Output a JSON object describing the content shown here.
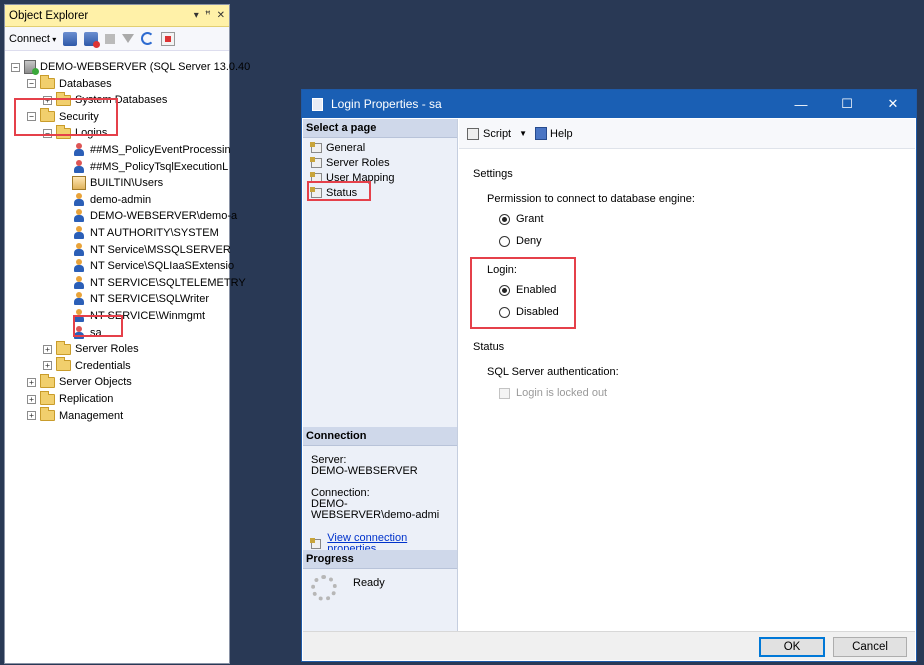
{
  "object_explorer": {
    "title": "Object Explorer",
    "title_buttons": [
      "▾",
      "ꟸ",
      "✕"
    ],
    "toolbar": {
      "connect_label": "Connect"
    },
    "tree": [
      {
        "label": "DEMO-WEBSERVER (SQL Server 13.0.40",
        "icon": "server",
        "indent": 0,
        "expander": "−"
      },
      {
        "label": "Databases",
        "icon": "folder",
        "indent": 1,
        "expander": "−"
      },
      {
        "label": "System Databases",
        "icon": "folder",
        "indent": 2,
        "expander": "+"
      },
      {
        "label": "Security",
        "icon": "folder",
        "indent": 1,
        "expander": "−"
      },
      {
        "label": "Logins",
        "icon": "folder",
        "indent": 2,
        "expander": "−"
      },
      {
        "label": "##MS_PolicyEventProcessin",
        "icon": "user-warn",
        "indent": 3,
        "expander": ""
      },
      {
        "label": "##MS_PolicyTsqlExecutionL",
        "icon": "user-warn",
        "indent": 3,
        "expander": ""
      },
      {
        "label": "BUILTIN\\Users",
        "icon": "group",
        "indent": 3,
        "expander": ""
      },
      {
        "label": "demo-admin",
        "icon": "user",
        "indent": 3,
        "expander": ""
      },
      {
        "label": "DEMO-WEBSERVER\\demo-a",
        "icon": "user",
        "indent": 3,
        "expander": ""
      },
      {
        "label": "NT AUTHORITY\\SYSTEM",
        "icon": "user",
        "indent": 3,
        "expander": ""
      },
      {
        "label": "NT Service\\MSSQLSERVER",
        "icon": "user",
        "indent": 3,
        "expander": ""
      },
      {
        "label": "NT Service\\SQLIaaSExtensio",
        "icon": "user",
        "indent": 3,
        "expander": ""
      },
      {
        "label": "NT SERVICE\\SQLTELEMETRY",
        "icon": "user",
        "indent": 3,
        "expander": ""
      },
      {
        "label": "NT SERVICE\\SQLWriter",
        "icon": "user",
        "indent": 3,
        "expander": ""
      },
      {
        "label": "NT SERVICE\\Winmgmt",
        "icon": "user",
        "indent": 3,
        "expander": ""
      },
      {
        "label": "sa",
        "icon": "user-warn",
        "indent": 3,
        "expander": ""
      },
      {
        "label": "Server Roles",
        "icon": "folder",
        "indent": 2,
        "expander": "+"
      },
      {
        "label": "Credentials",
        "icon": "folder",
        "indent": 2,
        "expander": "+"
      },
      {
        "label": "Server Objects",
        "icon": "folder",
        "indent": 1,
        "expander": "+"
      },
      {
        "label": "Replication",
        "icon": "folder",
        "indent": 1,
        "expander": "+"
      },
      {
        "label": "Management",
        "icon": "folder",
        "indent": 1,
        "expander": "+"
      }
    ]
  },
  "dialog": {
    "title": "Login Properties - sa",
    "window_buttons": {
      "minimize": "—",
      "maximize": "☐",
      "close": "✕"
    },
    "select_page_header": "Select a page",
    "pages": [
      "General",
      "Server Roles",
      "User Mapping",
      "Status"
    ],
    "connection": {
      "header": "Connection",
      "server_label": "Server:",
      "server_value": "DEMO-WEBSERVER",
      "connection_label": "Connection:",
      "connection_value": "DEMO-WEBSERVER\\demo-admi",
      "view_link": "View connection properties"
    },
    "progress": {
      "header": "Progress",
      "status": "Ready"
    },
    "toolbar": {
      "script_label": "Script",
      "script_dropdown": "▼",
      "help_label": "Help"
    },
    "settings": {
      "header": "Settings",
      "permission_label": "Permission to connect to database engine:",
      "grant_label": "Grant",
      "deny_label": "Deny",
      "permission_selected": "Grant",
      "login_label": "Login:",
      "enabled_label": "Enabled",
      "disabled_label": "Disabled",
      "login_selected": "Enabled"
    },
    "status": {
      "header": "Status",
      "auth_label": "SQL Server authentication:",
      "locked_out_label": "Login is locked out",
      "locked_out_checked": false
    },
    "buttons": {
      "ok": "OK",
      "cancel": "Cancel"
    }
  },
  "colors": {
    "desktop": "#293955",
    "oe_title_bg": "#fff1a8",
    "dialog_title_bg": "#1a5fb4",
    "highlight": "#e5404a"
  }
}
